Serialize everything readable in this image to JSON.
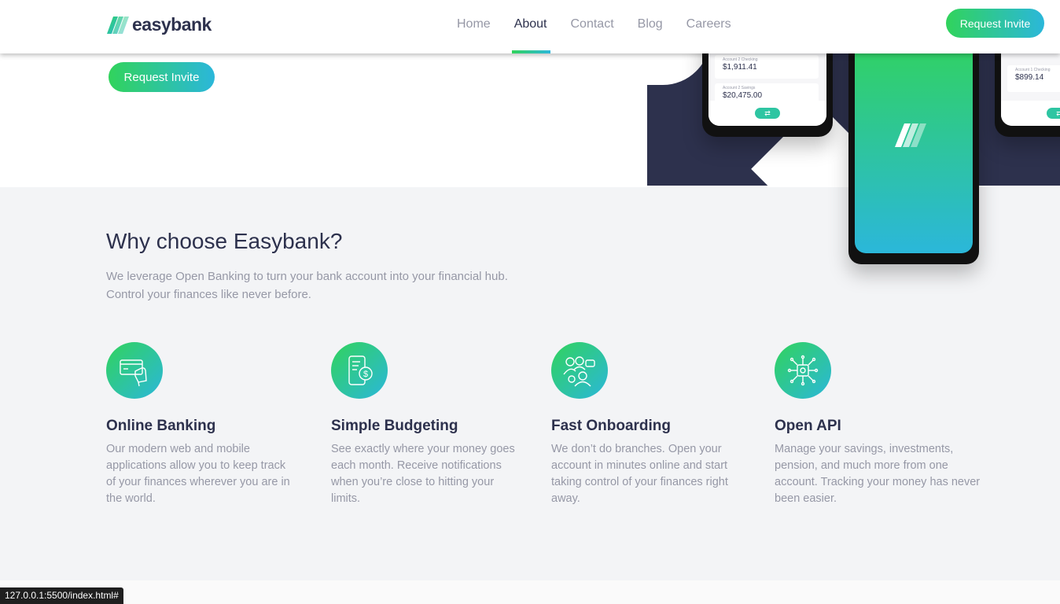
{
  "brand": {
    "name": "easybank"
  },
  "nav": {
    "items": [
      {
        "label": "Home"
      },
      {
        "label": "About"
      },
      {
        "label": "Contact"
      },
      {
        "label": "Blog"
      },
      {
        "label": "Careers"
      }
    ],
    "active": "About",
    "cta_label": "Request Invite"
  },
  "hero": {
    "cta_label": "Request Invite",
    "mockups": {
      "left_phone": [
        {
          "label": "Account 2 Checking",
          "amount": "$1,911.41"
        },
        {
          "label": "Account 2 Savings",
          "amount": "$20,475.00"
        }
      ],
      "right_phone": [
        {
          "label": "Account 1 Checking",
          "amount": "$899.14"
        }
      ]
    }
  },
  "why": {
    "title": "Why choose Easybank?",
    "description": "We leverage Open Banking to turn your bank account into your financial hub. Control your finances like never before."
  },
  "features": [
    {
      "icon": "online-banking-icon",
      "title": "Online Banking",
      "description": "Our modern web and mobile applications allow you to keep track of your finances wherever you are in the world."
    },
    {
      "icon": "budgeting-icon",
      "title": "Simple Budgeting",
      "description": "See exactly where your money goes each month. Receive notifications when you’re close to hitting your limits."
    },
    {
      "icon": "onboarding-icon",
      "title": "Fast Onboarding",
      "description": "We don’t do branches. Open your account in minutes online and start taking control of your finances right away."
    },
    {
      "icon": "api-icon",
      "title": "Open API",
      "description": "Manage your savings, investments, pension, and much more from one account. Tracking your money has never been easier."
    }
  ],
  "status_url": "127.0.0.1:5500/index.html#",
  "colors": {
    "dark_blue": "#2d314d",
    "lime_green": "#31d35c",
    "bright_cyan": "#2bb7da",
    "grayish_blue": "#9698a6",
    "light_gray": "#f3f4f6"
  }
}
